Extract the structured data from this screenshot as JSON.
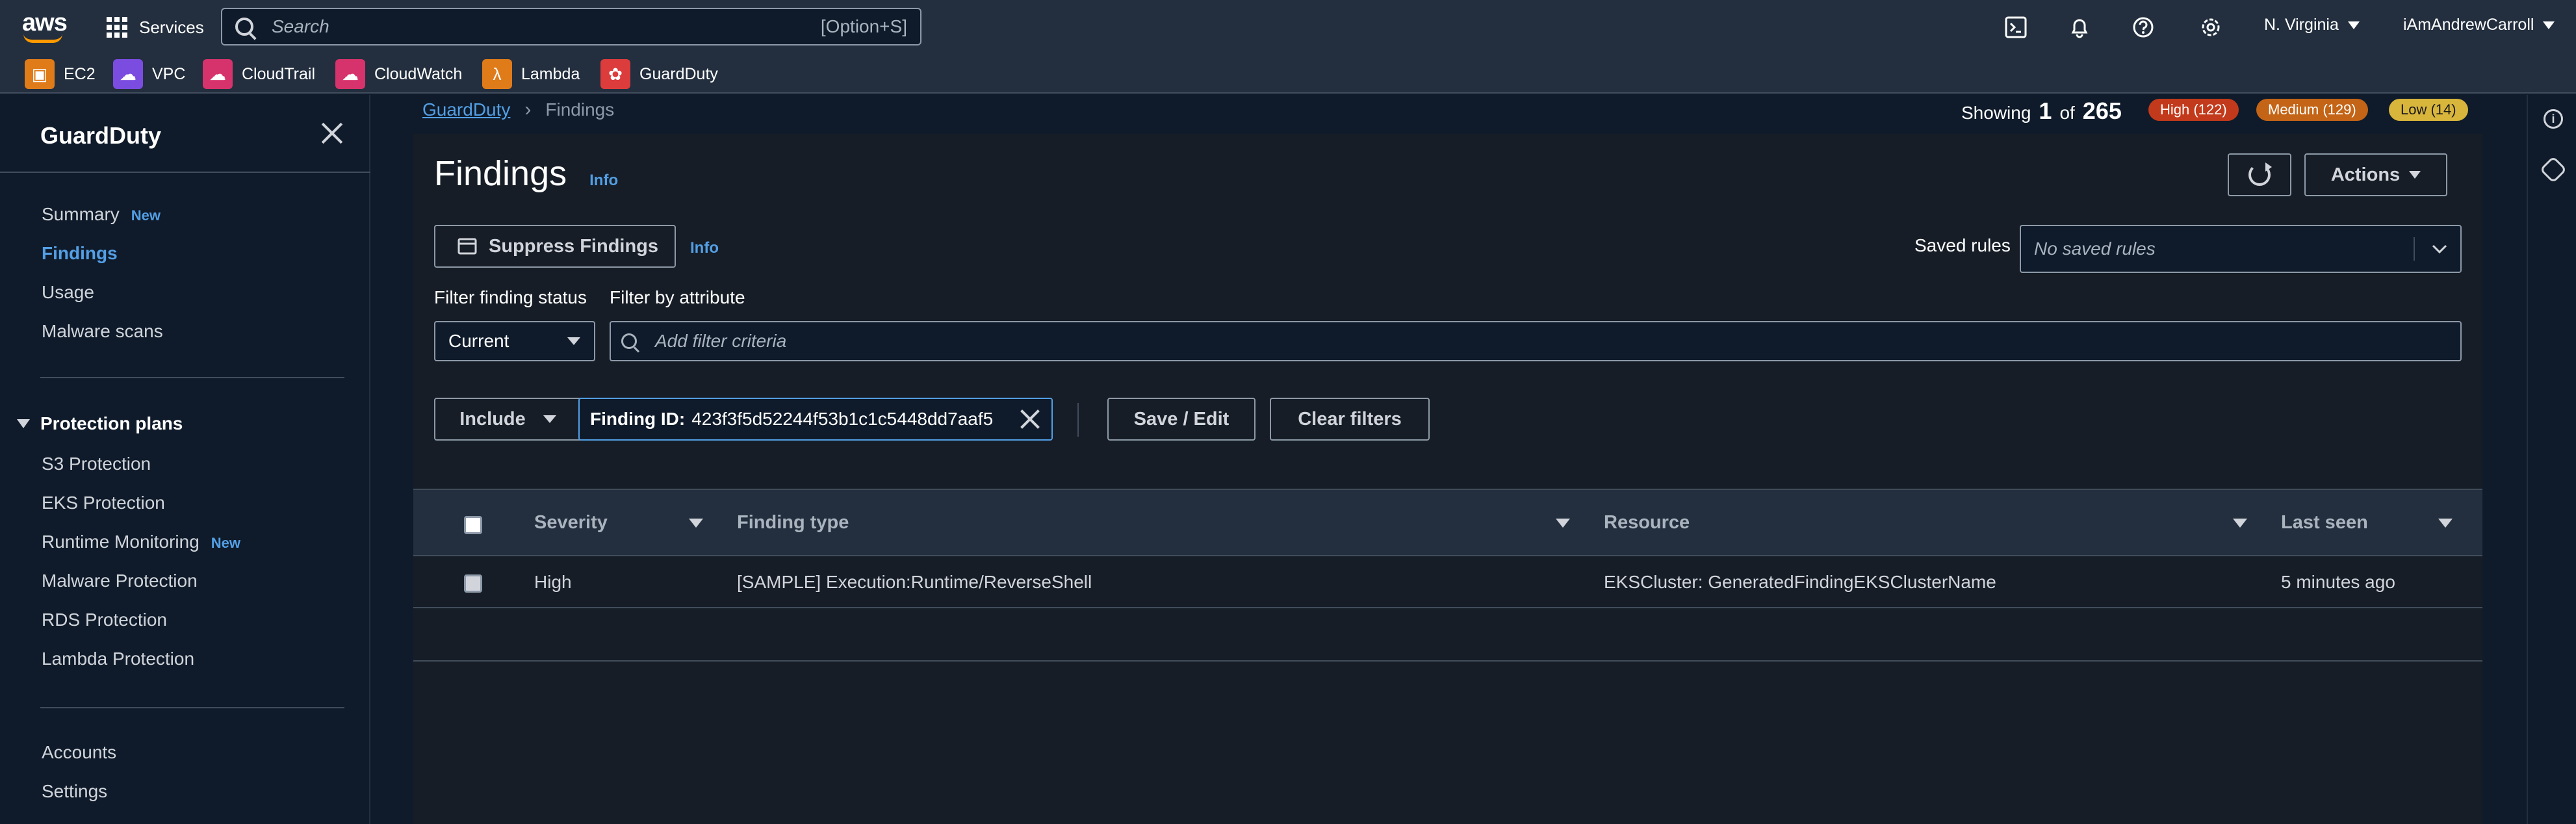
{
  "topnav": {
    "logo": "aws",
    "services_label": "Services",
    "search_placeholder": "Search",
    "search_shortcut": "[Option+S]",
    "region": "N. Virginia",
    "user": "iAmAndrewCarroll"
  },
  "favorites": [
    {
      "label": "EC2",
      "icon": "ec2-icon",
      "color": "#e07b1a"
    },
    {
      "label": "VPC",
      "icon": "vpc-icon",
      "color": "#7b4ce0"
    },
    {
      "label": "CloudTrail",
      "icon": "cloudtrail-icon",
      "color": "#d6336c"
    },
    {
      "label": "CloudWatch",
      "icon": "cloudwatch-icon",
      "color": "#d6336c"
    },
    {
      "label": "Lambda",
      "icon": "lambda-icon",
      "color": "#e07b1a"
    },
    {
      "label": "GuardDuty",
      "icon": "guardduty-icon",
      "color": "#dd3c3c"
    }
  ],
  "sidebar": {
    "title": "GuardDuty",
    "new_badge": "New",
    "items": [
      "Summary",
      "Findings",
      "Usage",
      "Malware scans"
    ],
    "protection_heading": "Protection plans",
    "protection_items": [
      "S3 Protection",
      "EKS Protection",
      "Runtime Monitoring",
      "Malware Protection",
      "RDS Protection",
      "Lambda Protection"
    ],
    "bottom_items": [
      "Accounts",
      "Settings"
    ]
  },
  "breadcrumb": {
    "root": "GuardDuty",
    "current": "Findings"
  },
  "summary": {
    "showing_prefix": "Showing",
    "showing_count": "1",
    "showing_of": "of",
    "showing_total": "265",
    "high": "High (122)",
    "medium": "Medium (129)",
    "low": "Low (14)",
    "high_color": "#ec4b25",
    "medium_color": "#e07b1a",
    "low_color": "#d8b53b"
  },
  "findings": {
    "title": "Findings",
    "info": "Info",
    "actions": "Actions",
    "suppress": "Suppress Findings",
    "saved_rules_label": "Saved rules",
    "saved_rules_value": "No saved rules",
    "filter_status_label": "Filter finding status",
    "filter_status_value": "Current",
    "filter_attr_label": "Filter by attribute",
    "filter_attr_placeholder": "Add filter criteria",
    "include": "Include",
    "token_key": "Finding ID:",
    "token_value": "423f3f5d52244f53b1c1c5448dd7aaf5",
    "save_edit": "Save / Edit",
    "clear_filters": "Clear filters"
  },
  "table": {
    "columns": [
      "Severity",
      "Finding type",
      "Resource",
      "Last seen"
    ],
    "rows": [
      {
        "severity": "High",
        "type": "[SAMPLE] Execution:Runtime/ReverseShell",
        "resource": "EKSCluster: GeneratedFindingEKSClusterName",
        "last_seen": "5 minutes ago"
      }
    ]
  }
}
